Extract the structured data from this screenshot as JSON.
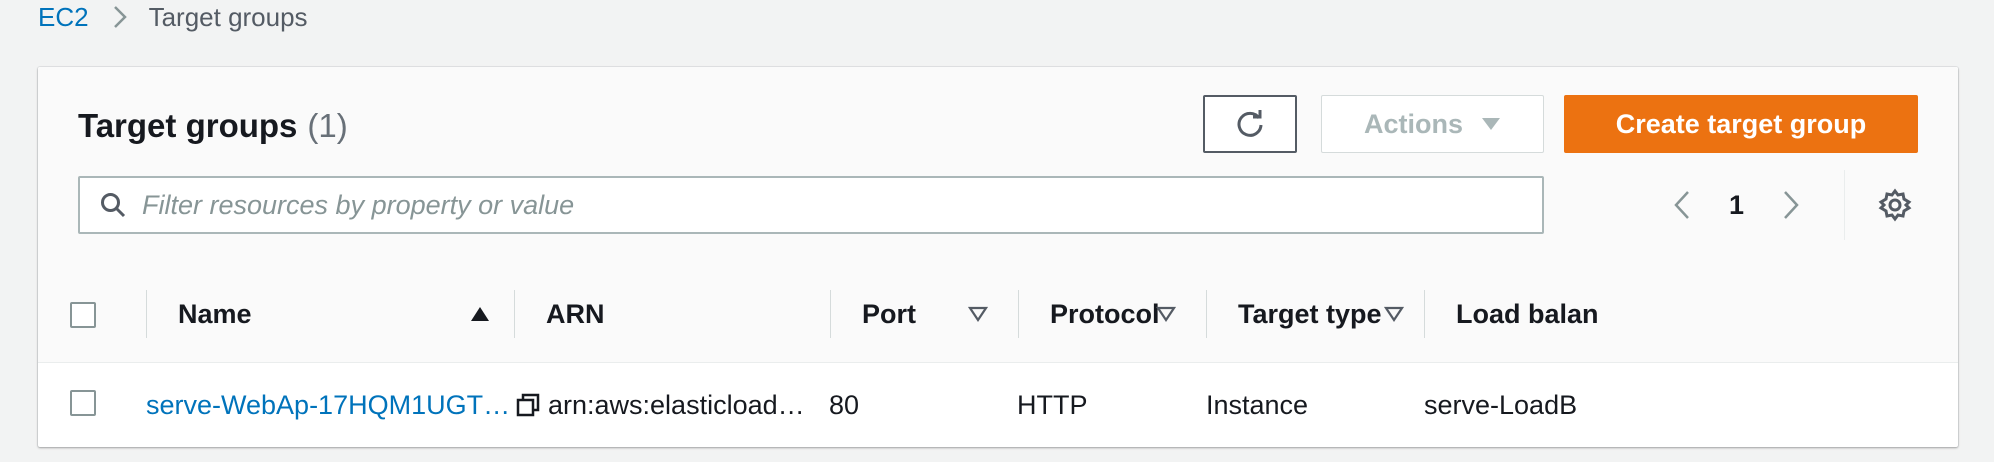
{
  "breadcrumb": {
    "items": [
      {
        "label": "EC2",
        "link": true
      },
      {
        "label": "Target groups",
        "link": false
      }
    ]
  },
  "panel": {
    "title": "Target groups",
    "count": "(1)"
  },
  "toolbar": {
    "refresh_icon": "refresh-icon",
    "actions_label": "Actions",
    "create_label": "Create target group"
  },
  "search": {
    "placeholder": "Filter resources by property or value",
    "value": ""
  },
  "pagination": {
    "current_page": "1"
  },
  "table": {
    "columns": [
      {
        "label": "Name",
        "sort": "ascending"
      },
      {
        "label": "ARN",
        "sort": "none"
      },
      {
        "label": "Port",
        "sort": "sortable"
      },
      {
        "label": "Protocol",
        "sort": "sortable"
      },
      {
        "label": "Target type",
        "sort": "sortable"
      },
      {
        "label": "Load balan",
        "sort": "sortable"
      }
    ],
    "rows": [
      {
        "name": "serve-WebAp-17HQM1UGT…",
        "arn": "arn:aws:elasticload…",
        "port": "80",
        "protocol": "HTTP",
        "target_type": "Instance",
        "load_balancer": "serve-LoadB"
      }
    ]
  },
  "colors": {
    "link": "#0073bb",
    "primary": "#ec7211",
    "disabled": "#aab7b8"
  }
}
